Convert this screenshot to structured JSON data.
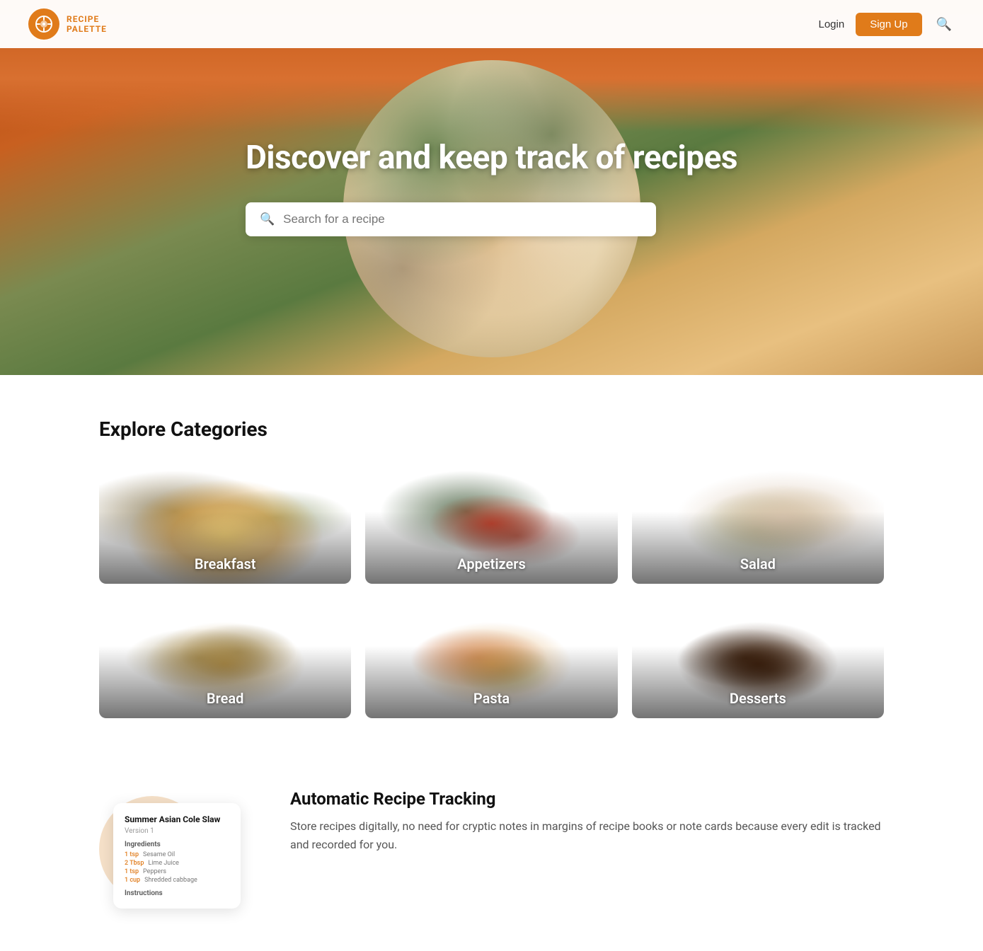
{
  "brand": {
    "name": "RECIPE\nPALETTE",
    "logo_alt": "Recipe Palette Logo"
  },
  "navbar": {
    "login_label": "Login",
    "signup_label": "Sign Up"
  },
  "hero": {
    "title": "Discover and keep track of recipes",
    "search_placeholder": "Search for a recipe"
  },
  "categories_section": {
    "title": "Explore Categories",
    "categories": [
      {
        "id": "breakfast",
        "label": "Breakfast"
      },
      {
        "id": "appetizers",
        "label": "Appetizers"
      },
      {
        "id": "salad",
        "label": "Salad"
      },
      {
        "id": "bread",
        "label": "Bread"
      },
      {
        "id": "pasta",
        "label": "Pasta"
      },
      {
        "id": "desserts",
        "label": "Desserts"
      }
    ]
  },
  "feature": {
    "title": "Automatic Recipe Tracking",
    "description": "Store recipes digitally, no need for cryptic notes in margins of recipe books or note cards because every edit is tracked and recorded for you.",
    "recipe_card": {
      "title": "Summer Asian Cole Slaw",
      "version": "Version 1",
      "ingredients_label": "Ingredients",
      "ingredients": [
        {
          "amount": "1 tsp",
          "name": "Sesame Oil"
        },
        {
          "amount": "2 Tbsp",
          "name": "Lime Juice"
        },
        {
          "amount": "1 tsp",
          "name": "Peppers"
        },
        {
          "amount": "1 cup",
          "name": "Shredded cabbage"
        }
      ],
      "instructions_label": "Instructions"
    }
  }
}
